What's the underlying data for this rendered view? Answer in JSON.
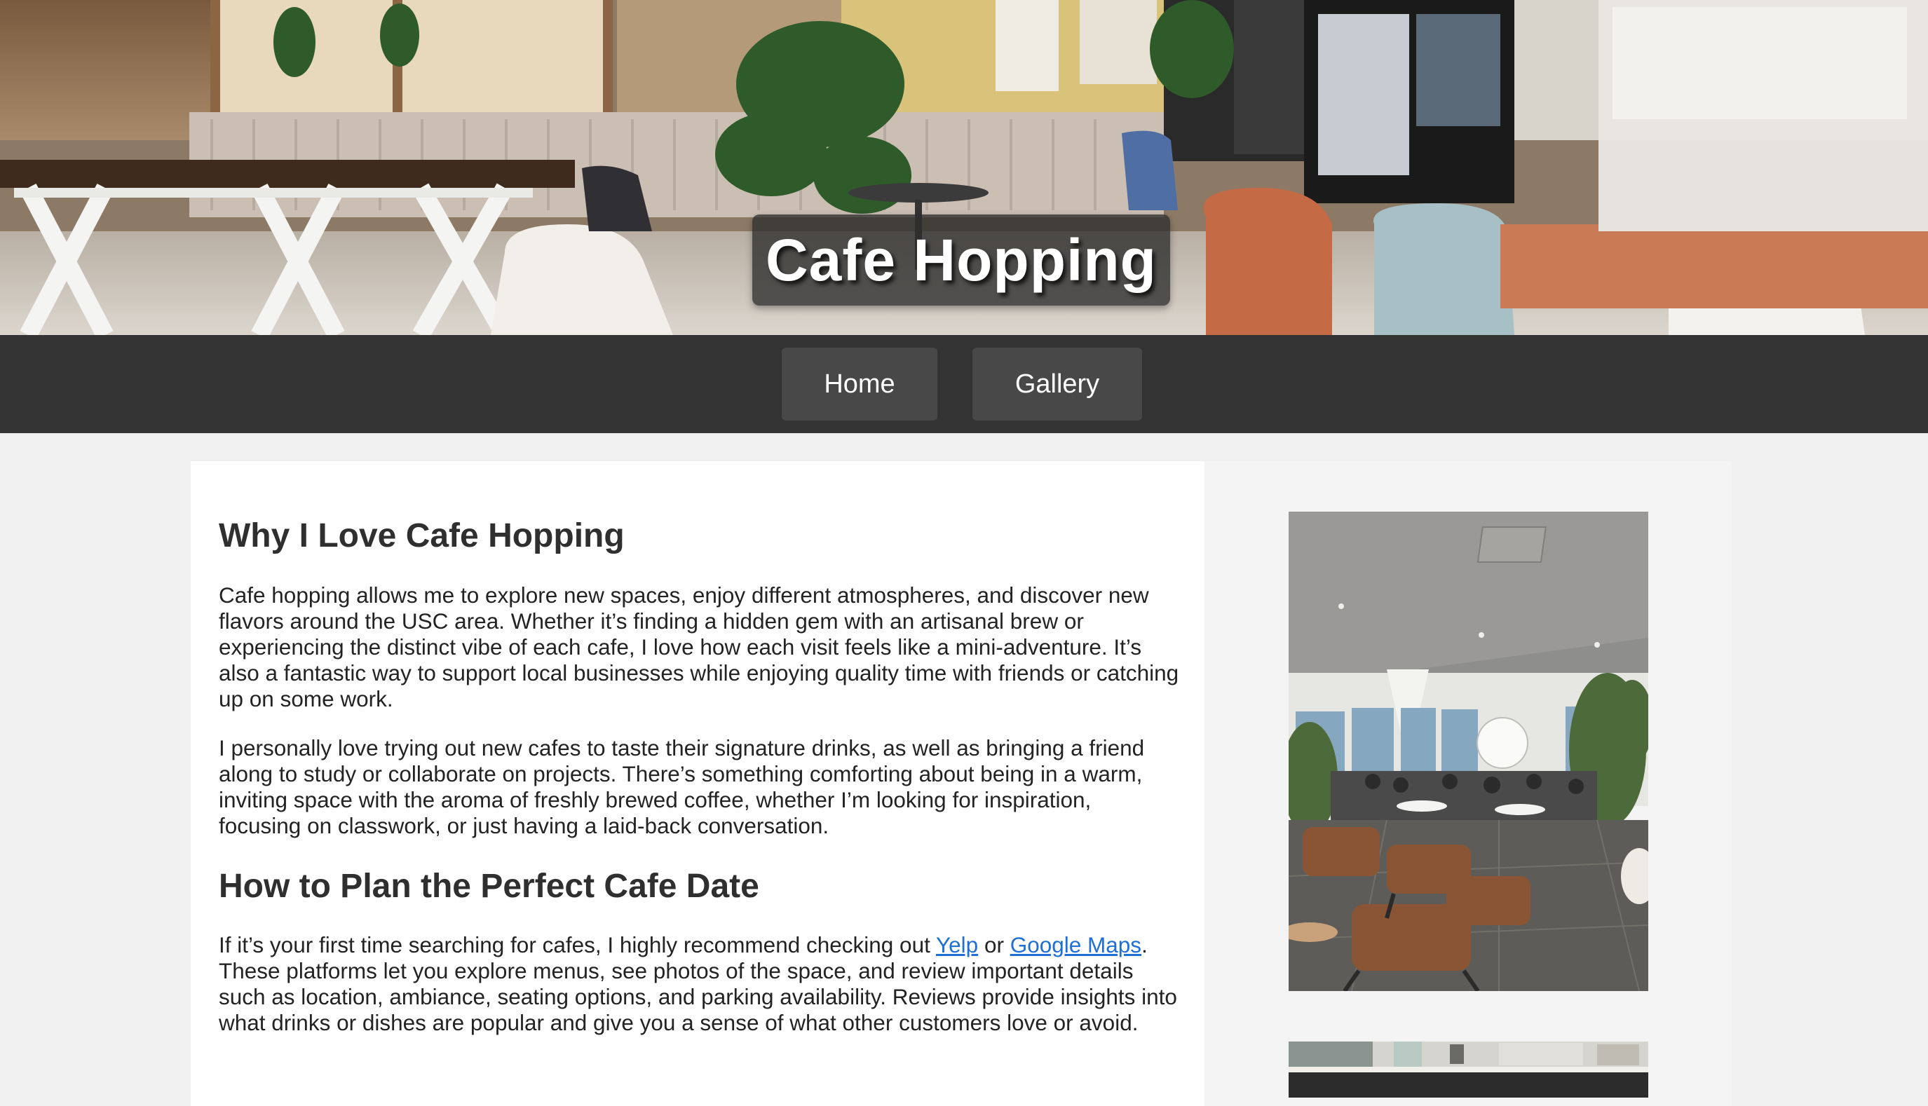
{
  "site": {
    "title": "Cafe Hopping"
  },
  "nav": {
    "items": [
      {
        "label": "Home"
      },
      {
        "label": "Gallery"
      }
    ]
  },
  "article": {
    "section1": {
      "heading": "Why I Love Cafe Hopping",
      "paragraphs": [
        "Cafe hopping allows me to explore new spaces, enjoy different atmospheres, and discover new flavors around the USC area. Whether it’s finding a hidden gem with an artisanal brew or experiencing the distinct vibe of each cafe, I love how each visit feels like a mini-adventure. It’s also a fantastic way to support local businesses while enjoying quality time with friends or catching up on some work.",
        "I personally love trying out new cafes to taste their signature drinks, as well as bringing a friend along to study or collaborate on projects. There’s something comforting about being in a warm, inviting space with the aroma of freshly brewed coffee, whether I’m looking for inspiration, focusing on classwork, or just having a laid-back conversation."
      ]
    },
    "section2": {
      "heading": "How to Plan the Perfect Cafe Date",
      "paragraph": {
        "before": "If it’s your first time searching for cafes, I highly recommend checking out ",
        "link1": "Yelp",
        "between": " or ",
        "link2": "Google Maps",
        "after": ". These platforms let you explore menus, see photos of the space, and review important details such as location, ambiance, seating options, and parking availability. Reviews provide insights into what drinks or dishes are popular and give you a sense of what other customers love or avoid."
      }
    }
  },
  "sidebar": {
    "photos": [
      {
        "name": "cafe-interior-photo"
      },
      {
        "name": "cafe-counter-photo"
      }
    ]
  },
  "colors": {
    "nav_bg": "#333333",
    "nav_button_bg": "#484848",
    "page_bg": "#f0f0f0",
    "link": "#1f6fd6"
  }
}
